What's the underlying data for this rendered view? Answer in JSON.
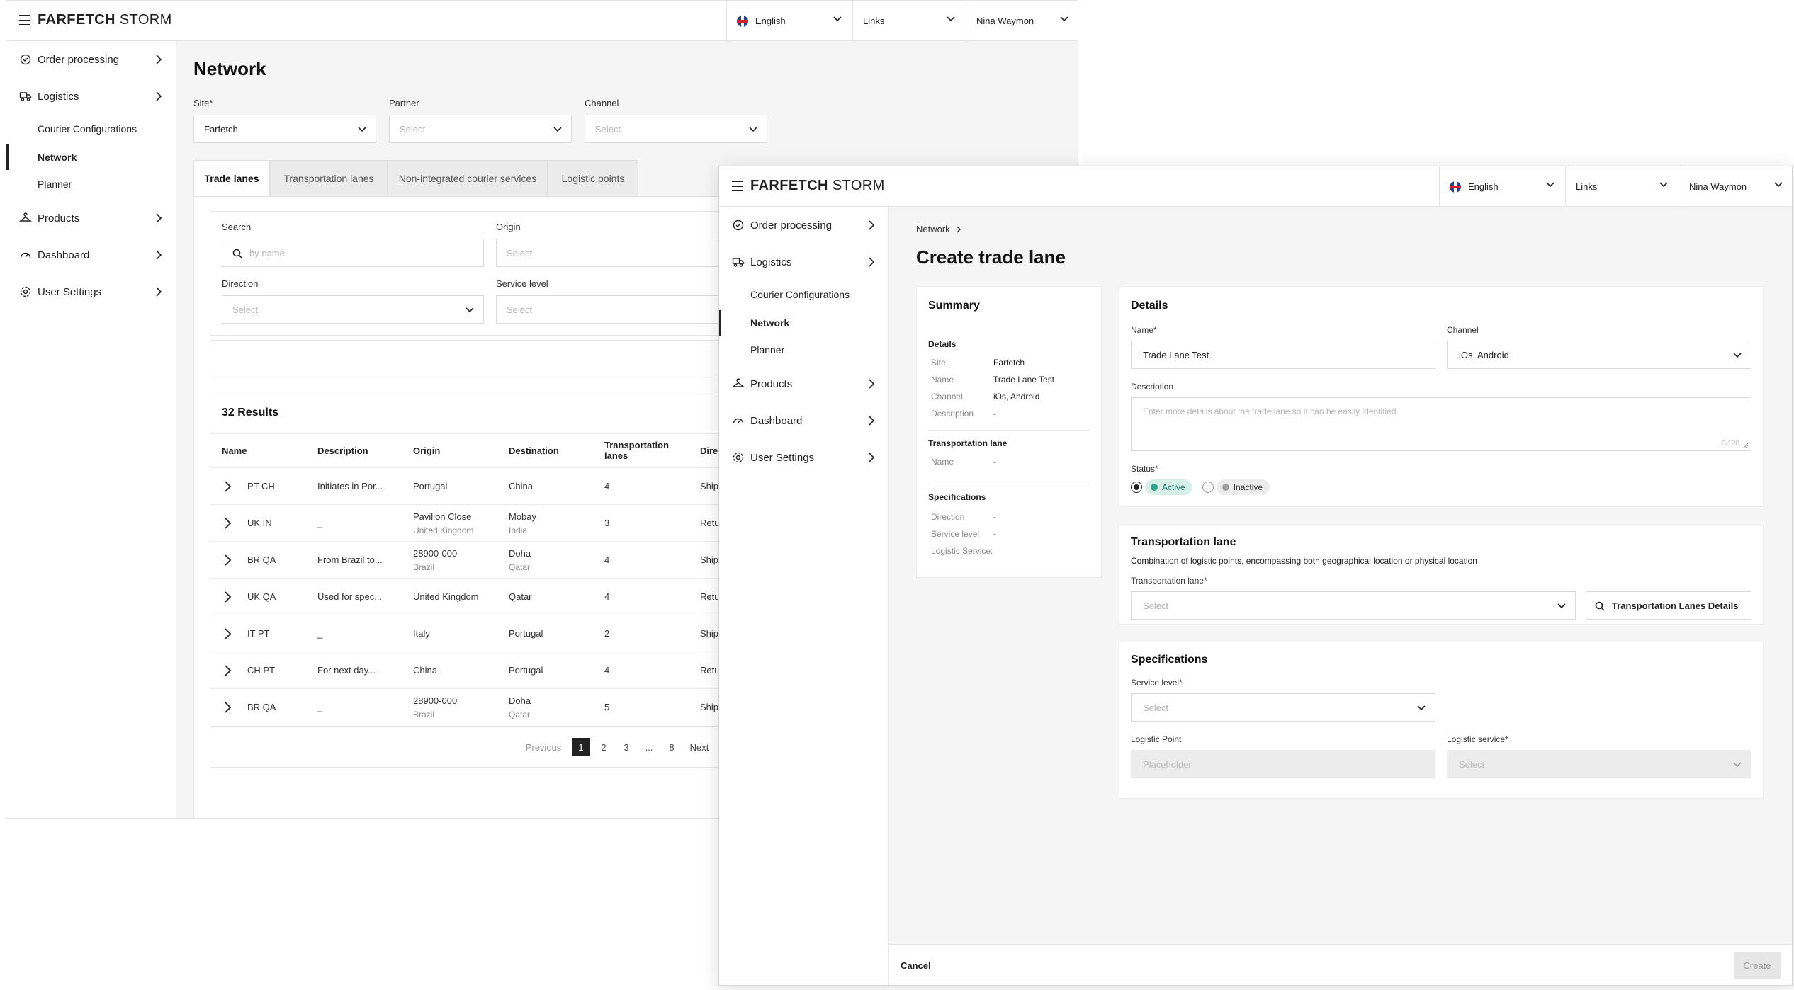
{
  "brand": {
    "logo_bold": "FARFETCH",
    "logo_light": "STORM"
  },
  "topbar": {
    "language": "English",
    "links": "Links",
    "user": "Nina Waymon"
  },
  "sidebar": {
    "items": [
      {
        "label": "Order processing",
        "icon": "order-processing-icon"
      },
      {
        "label": "Logistics",
        "icon": "truck-icon"
      },
      {
        "label": "Products",
        "icon": "hanger-icon"
      },
      {
        "label": "Dashboard",
        "icon": "gauge-icon"
      },
      {
        "label": "User Settings",
        "icon": "gear-icon"
      }
    ],
    "logistics_sub": [
      "Courier Configurations",
      "Network",
      "Planner"
    ]
  },
  "network": {
    "title": "Network",
    "filters": {
      "site_label": "Site*",
      "site_value": "Farfetch",
      "partner_label": "Partner",
      "partner_placeholder": "Select",
      "channel_label": "Channel",
      "channel_placeholder": "Select"
    },
    "tabs": [
      "Trade lanes",
      "Transportation lanes",
      "Non-integrated courier services",
      "Logistic points"
    ],
    "search": {
      "search_label": "Search",
      "search_placeholder": "by name",
      "origin_label": "Origin",
      "origin_placeholder": "Select",
      "direction_label": "Direction",
      "direction_placeholder": "Select",
      "service_level_label": "Service level",
      "service_level_placeholder": "Select"
    },
    "results_title": "32 Results",
    "columns": [
      "Name",
      "Description",
      "Origin",
      "Destination",
      "Transportation lanes",
      "Direc"
    ],
    "rows": [
      {
        "name": "PT CH",
        "description": "Initiates in Por...",
        "origin": "Portugal",
        "origin_sub": "",
        "destination": "China",
        "destination_sub": "",
        "lanes": "4",
        "direction": "Shipp"
      },
      {
        "name": "UK IN",
        "description": "_",
        "origin": "Pavilion Close",
        "origin_sub": "United Kingdom",
        "destination": "Mobay",
        "destination_sub": "India",
        "lanes": "3",
        "direction": "Retur"
      },
      {
        "name": "BR QA",
        "description": "From Brazil to...",
        "origin": "28900-000",
        "origin_sub": "Brazil",
        "destination": "Doha",
        "destination_sub": "Qatar",
        "lanes": "4",
        "direction": "Shipp"
      },
      {
        "name": "UK QA",
        "description": "Used for spec...",
        "origin": "United Kingdom",
        "origin_sub": "",
        "destination": "Qatar",
        "destination_sub": "",
        "lanes": "4",
        "direction": "Retur"
      },
      {
        "name": "IT PT",
        "description": "_",
        "origin": "Italy",
        "origin_sub": "",
        "destination": "Portugal",
        "destination_sub": "",
        "lanes": "2",
        "direction": "Shipp"
      },
      {
        "name": "CH PT",
        "description": "For next day...",
        "origin": "China",
        "origin_sub": "",
        "destination": "Portugal",
        "destination_sub": "",
        "lanes": "4",
        "direction": "Retur"
      },
      {
        "name": "BR QA",
        "description": "_",
        "origin": "28900-000",
        "origin_sub": "Brazil",
        "destination": "Doha",
        "destination_sub": "Qatar",
        "lanes": "5",
        "direction": "Shipp"
      }
    ],
    "pagination": {
      "previous": "Previous",
      "pages": [
        "1",
        "2",
        "3",
        "...",
        "8"
      ],
      "next": "Next"
    }
  },
  "create": {
    "breadcrumb": "Network",
    "title": "Create trade lane",
    "summary": {
      "title": "Summary",
      "details_title": "Details",
      "details": [
        {
          "key": "Site",
          "value": "Farfetch"
        },
        {
          "key": "Name",
          "value": "Trade Lane Test"
        },
        {
          "key": "Channel",
          "value": "iOs, Android"
        },
        {
          "key": "Description",
          "value": "-"
        }
      ],
      "lane_title": "Transportation lane",
      "lane": [
        {
          "key": "Name",
          "value": "-"
        }
      ],
      "spec_title": "Specifications",
      "spec": [
        {
          "key": "Direction",
          "value": "-"
        },
        {
          "key": "Service level",
          "value": "-"
        },
        {
          "key": "Logistic Service:",
          "value": ""
        }
      ]
    },
    "details": {
      "title": "Details",
      "name_label": "Name*",
      "name_value": "Trade Lane Test",
      "channel_label": "Channel",
      "channel_value": "iOs, Android",
      "description_label": "Description",
      "description_placeholder": "Enter more details about the trade lane so it can be easily identified",
      "description_counter": "0/120",
      "status_label": "Status*",
      "status_active": "Active",
      "status_inactive": "Inactive"
    },
    "transport": {
      "title": "Transportation lane",
      "subtitle": "Combination of logistic points, encompassing both geographical location or physical location",
      "lane_label": "Transportation lane*",
      "lane_placeholder": "Select",
      "details_button": "Transportation Lanes Details"
    },
    "specs": {
      "title": "Specifications",
      "service_level_label": "Service level*",
      "service_level_placeholder": "Select",
      "logistic_point_label": "Logistic Point",
      "logistic_point_placeholder": "Placeholder",
      "logistic_service_label": "Logistic service*",
      "logistic_service_placeholder": "Select"
    },
    "footer": {
      "cancel": "Cancel",
      "create": "Create"
    },
    "colors": {
      "active_badge": "#d7efe9",
      "active_dot": "#2fa58f",
      "inactive_badge": "#ececec",
      "inactive_dot": "#9e9e9e"
    }
  }
}
